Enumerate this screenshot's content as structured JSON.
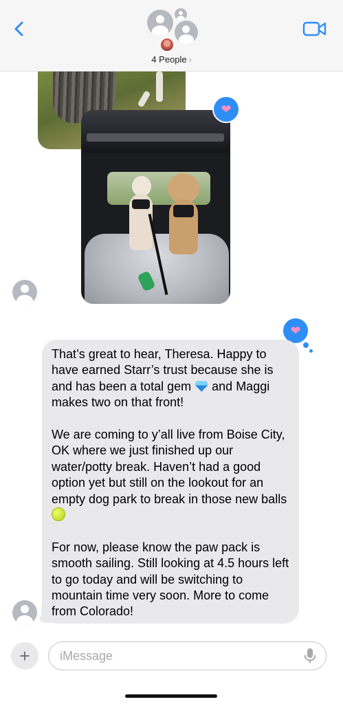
{
  "header": {
    "participants_label": "4 People",
    "participants_chevron": "›",
    "back_icon": "chevron-left-icon",
    "video_icon": "video-camera-icon"
  },
  "colors": {
    "accent": "#2f8ef5",
    "bubble_gray": "#e9e9eb",
    "reaction_heart": "#ff8fc2"
  },
  "thread": {
    "photo_1": {
      "type": "image",
      "subject": "tree-trunk-grass"
    },
    "photo_2": {
      "type": "image",
      "subject": "two-dogs-in-car",
      "reaction": "heart"
    },
    "message": {
      "paragraphs": [
        {
          "before": "That’s great to hear, Theresa. Happy to have earned Starr’s trust because she is and has been a total gem ",
          "emoji": "gem-emoji",
          "after": " and Maggi makes two on that front!"
        },
        {
          "before": "We are coming to y’all live from Boise City, OK where we just finished up our water/potty break. Haven’t had a good option yet but still on the lookout for an empty dog park to break in those new balls ",
          "emoji": "tennis-ball-emoji",
          "after": ""
        },
        {
          "before": "For now, please know the paw pack is smooth sailing. Still looking at 4.5 hours left to go today and will be switching to mountain time very soon. More to come from Colorado!",
          "emoji": "",
          "after": ""
        }
      ],
      "reaction": "heart"
    }
  },
  "composer": {
    "placeholder": "iMessage",
    "value": "",
    "plus_label": "+",
    "mic_icon": "microphone-icon"
  }
}
